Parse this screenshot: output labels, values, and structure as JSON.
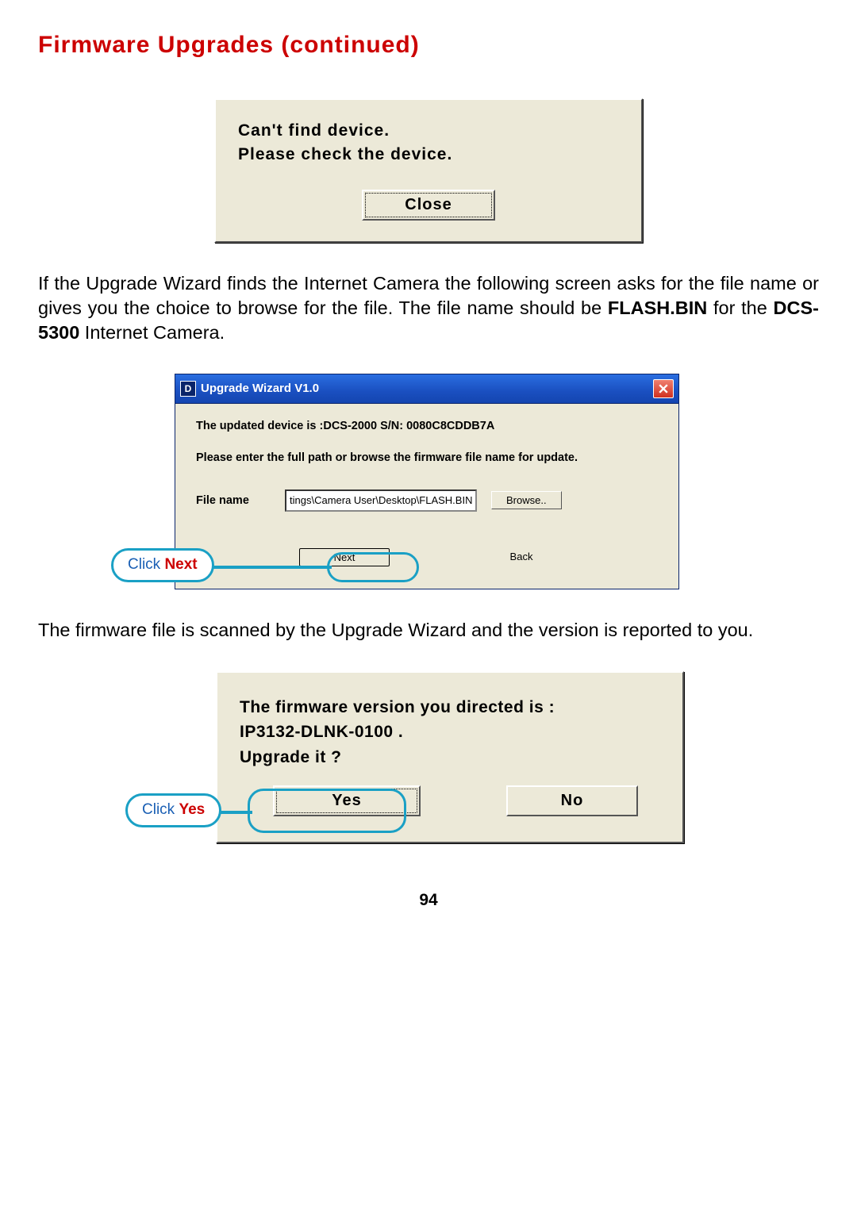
{
  "title": "Firmware Upgrades (continued)",
  "dialog1": {
    "line1": "Can't find device.",
    "line2": "Please check the device.",
    "close": "Close"
  },
  "para1": {
    "t1": "If the Upgrade Wizard finds the Internet Camera the following screen asks for the file name or gives you the choice to browse for the file.  The file name should be ",
    "b1": "FLASH.BIN",
    "t2": " for the ",
    "b2": "DCS-5300",
    "t3": " Internet Camera."
  },
  "wizard": {
    "title": "Upgrade Wizard V1.0",
    "icon_letter": "D",
    "line1": "The updated device is :DCS-2000 S/N: 0080C8CDDB7A",
    "line2": "Please enter the full path or browse the firmware file name for update.",
    "file_label": "File name",
    "file_value": "tings\\Camera User\\Desktop\\FLASH.BIN",
    "browse": "Browse..",
    "next": "Next",
    "back": "Back"
  },
  "callout_next": {
    "prefix": "Click ",
    "word": "Next"
  },
  "para2": "The firmware file is scanned by the Upgrade Wizard and the version is reported to you.",
  "dialog3": {
    "line1": "The firmware version you directed is :",
    "line2": "IP3132-DLNK-0100 .",
    "line3": "Upgrade it ?",
    "yes": "Yes",
    "no": "No"
  },
  "callout_yes": {
    "prefix": "Click ",
    "word": "Yes"
  },
  "page": "94"
}
